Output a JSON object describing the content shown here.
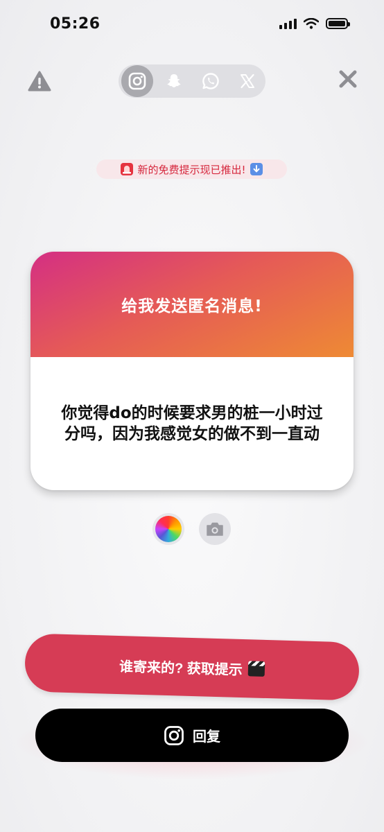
{
  "status_bar": {
    "time": "05:26"
  },
  "platforms": {
    "active": "instagram",
    "items": [
      "instagram-icon",
      "snapchat-icon",
      "whatsapp-icon",
      "x-icon"
    ]
  },
  "promo": {
    "text": "新的免费提示现已推出!"
  },
  "card": {
    "title": "给我发送匿名消息!",
    "message": "你觉得do的时候要求男的桩一小时过分吗，因为我感觉女的做不到一直动"
  },
  "hint_button": {
    "label": "谁寄来的? 获取提示"
  },
  "reply_button": {
    "label": "回复"
  },
  "colors": {
    "accent_red": "#d63c55",
    "card_gradient_start": "#d42f83",
    "card_gradient_end": "#ee8a34",
    "promo_text": "#d6273d"
  }
}
